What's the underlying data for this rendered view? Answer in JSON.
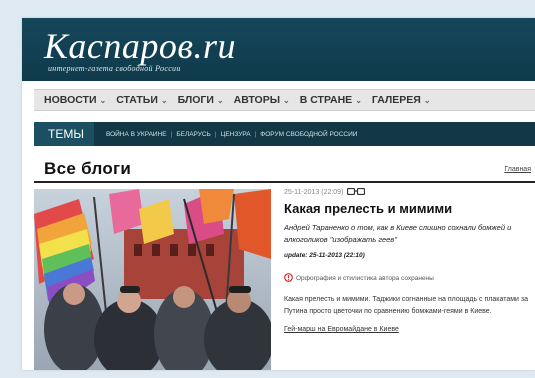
{
  "header": {
    "logo": "Каспаров.ru",
    "tagline": "интернет-газета свободной России"
  },
  "nav": {
    "items": [
      {
        "label": "НОВОСТИ"
      },
      {
        "label": "СТАТЬИ"
      },
      {
        "label": "БЛОГИ"
      },
      {
        "label": "АВТОРЫ"
      },
      {
        "label": "В СТРАНЕ"
      },
      {
        "label": "ГАЛЕРЕЯ"
      }
    ],
    "chevron": "⌄"
  },
  "themes": {
    "label": "ТЕМЫ",
    "links": [
      "ВОЙНА В УКРАИНЕ",
      "БЕЛАРУСЬ",
      "ЦЕНЗУРА",
      "ФОРУМ СВОБОДНОЙ РОССИИ"
    ],
    "separator": "|"
  },
  "section": {
    "title": "Все блоги",
    "home_link": "Главная"
  },
  "post": {
    "meta_date": "25-11-2013 (22:09)",
    "meta_author": "",
    "title": "Какая прелесть и мимими",
    "lead": "Андрей Тараненко о том, как в Киеве слишно сохнали бомжей и алкоголиков \"изображать геев\"",
    "update": "update: 25-11-2013 (22:10)",
    "spelling_note": "Орфография и стилистика автора сохранены",
    "body": "Какая прелесть и мимими. Таджики согнанные на площадь с плакатами за Путина просто цветочки по сравнению бомжами-геями в Киеве.",
    "related_link": "Гей-марш на Евромайдане в Киеве"
  },
  "icons": {
    "glasses": "glasses-icon",
    "warning": "warning-icon"
  },
  "colors": {
    "header_bg": "#15475a",
    "themes_bg": "#123846",
    "warning": "#d22222"
  }
}
